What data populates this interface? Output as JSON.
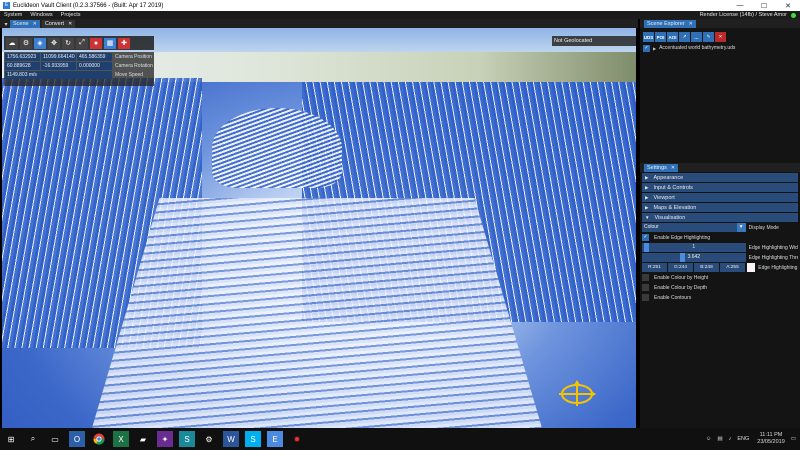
{
  "window": {
    "title": "Euclideon Vault Client (0.2.3.37566 - (Built: Apr 17 2019)",
    "minimize": "—",
    "maximize": "☐",
    "close": "✕"
  },
  "menu": {
    "items": [
      "System",
      "Windows",
      "Projects"
    ],
    "license": "Render License (14fb) / Steve Amor"
  },
  "scene": {
    "tabs": [
      {
        "label": "Scene",
        "active": true
      },
      {
        "label": "Convert",
        "active": false
      }
    ],
    "geolocation": "Not Geolocated",
    "camera": {
      "position": [
        "1756.632923",
        "11099.664140",
        "465.586359"
      ],
      "position_label": "Camera Position",
      "rotation": [
        "60.889628",
        "-16.933959",
        "0.000000"
      ],
      "rotation_label": "Camera Rotation",
      "speed": "1149.803 m/s",
      "speed_label": "Move Speed"
    },
    "toolbar_icons": [
      "cloud-icon",
      "gear-icon",
      "shield-icon",
      "move-icon",
      "rotate-icon",
      "scale-icon",
      "uds-icon",
      "map-icon",
      "measure-icon"
    ]
  },
  "explorer": {
    "tab": "Scene Explorer",
    "tools": [
      "UDS",
      "POI",
      "AOI",
      "↗",
      "…",
      "✎",
      "✕"
    ],
    "items": [
      {
        "label": "Accentuated world bathymetry.uds",
        "checked": true
      }
    ]
  },
  "settings": {
    "tab": "Settings",
    "sections": [
      "Appearance",
      "Input & Controls",
      "Viewport",
      "Maps & Elevation",
      "Visualisation"
    ],
    "display_mode": {
      "value": "Colour",
      "label": "Display Mode"
    },
    "edge_highlighting": {
      "label": "Enable Edge Highlighting",
      "checked": true
    },
    "edge_width": {
      "value": "1",
      "label": "Edge Highlighting Width",
      "level": 0.02
    },
    "edge_threshold": {
      "value": "3.642",
      "label": "Edge Highlighting Threshold",
      "level": 0.37
    },
    "edge_colour": {
      "r": "R:251",
      "g": "G:244",
      "b": "B:248",
      "a": "A:255",
      "label": "Edge Highlighting Colour",
      "swatch": "#fbf4f8"
    },
    "colour_by_height": "Enable Colour by Height",
    "colour_by_depth": "Enable Colour by Depth",
    "contours": "Enable Contours"
  },
  "taskbar": {
    "lang": "ENG",
    "time": "11:11 PM",
    "date": "23/05/2019"
  },
  "colors": {
    "accent": "#2f6fb5",
    "panel": "#141414"
  }
}
